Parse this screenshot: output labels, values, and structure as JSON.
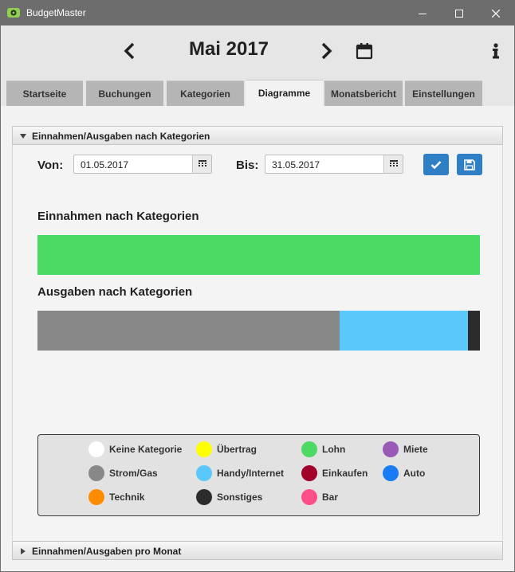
{
  "window": {
    "title": "BudgetMaster"
  },
  "header": {
    "month": "Mai 2017"
  },
  "tabs": [
    {
      "label": "Startseite"
    },
    {
      "label": "Buchungen"
    },
    {
      "label": "Kategorien"
    },
    {
      "label": "Diagramme"
    },
    {
      "label": "Monatsbericht"
    },
    {
      "label": "Einstellungen"
    }
  ],
  "active_tab": "Diagramme",
  "panel1": {
    "title": "Einnahmen/Ausgaben nach Kategorien",
    "von_label": "Von:",
    "von_value": "01.05.2017",
    "bis_label": "Bis:",
    "bis_value": "31.05.2017",
    "income_title": "Einnahmen nach Kategorien",
    "expense_title": "Ausgaben nach Kategorien"
  },
  "panel2": {
    "title": "Einnahmen/Ausgaben pro Monat"
  },
  "legend": [
    {
      "label": "Keine Kategorie",
      "color": "#ffffff"
    },
    {
      "label": "Übertrag",
      "color": "#ffff00"
    },
    {
      "label": "Lohn",
      "color": "#4cd964"
    },
    {
      "label": "Miete",
      "color": "#9b59b6"
    },
    {
      "label": "Strom/Gas",
      "color": "#888888"
    },
    {
      "label": "Handy/Internet",
      "color": "#5ac8fa"
    },
    {
      "label": "Einkaufen",
      "color": "#a0002a"
    },
    {
      "label": "Auto",
      "color": "#1a7cf5"
    },
    {
      "label": "Technik",
      "color": "#ff8c00"
    },
    {
      "label": "Sonstiges",
      "color": "#2c2c2c"
    },
    {
      "label": "Bar",
      "color": "#ff4f8b"
    }
  ],
  "chart_data": [
    {
      "type": "bar",
      "title": "Einnahmen nach Kategorien",
      "segments": [
        {
          "category": "Lohn",
          "share": 1.0,
          "color": "#4cd964"
        }
      ]
    },
    {
      "type": "bar",
      "title": "Ausgaben nach Kategorien",
      "segments": [
        {
          "category": "Strom/Gas",
          "share": 0.683,
          "color": "#888888"
        },
        {
          "category": "Handy/Internet",
          "share": 0.29,
          "color": "#5ac8fa"
        },
        {
          "category": "Sonstiges",
          "share": 0.027,
          "color": "#2c2c2c"
        }
      ]
    }
  ]
}
